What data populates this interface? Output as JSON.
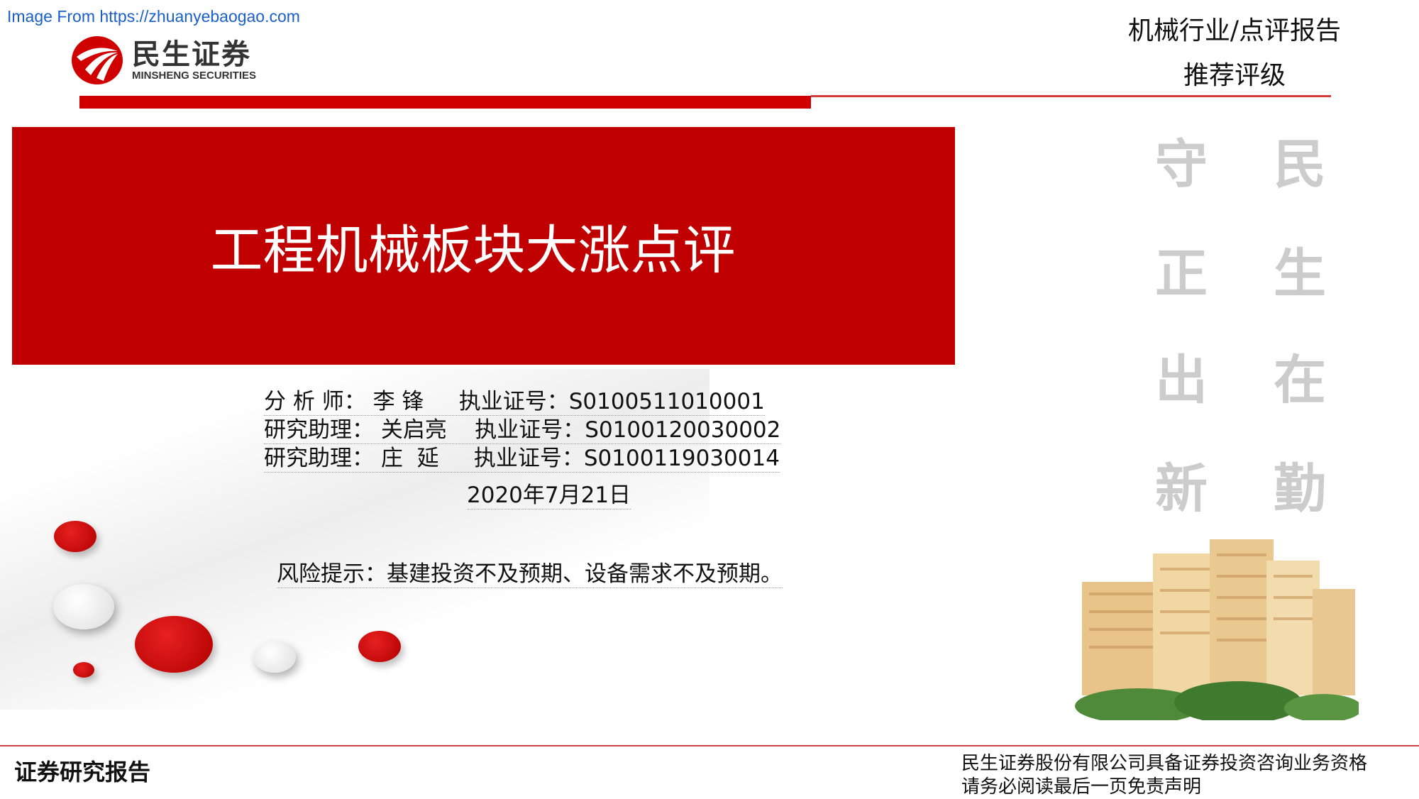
{
  "watermark": "Image From https://zhuanyebaogao.com",
  "logo": {
    "cn": "民生证券",
    "en": "MINSHENG SECURITIES",
    "color": "#d10000"
  },
  "header": {
    "category": "机械行业/点评报告",
    "rating_label": "推荐评级"
  },
  "banner": {
    "title": "工程机械板块大涨点评",
    "color": "#c00000"
  },
  "authors": [
    {
      "role": "分 析 师：",
      "name": "李 锋",
      "cert_label": "执业证号：",
      "cert": "S0100511010001"
    },
    {
      "role": "研究助理：",
      "name": "关启亮",
      "cert_label": "执业证号：",
      "cert": "S0100120030002"
    },
    {
      "role": "研究助理：",
      "name": "庄  延",
      "cert_label": "执业证号：",
      "cert": "S0100119030014"
    }
  ],
  "date": "2020年7月21日",
  "risk": "风险提示：基建投资不及预期、设备需求不及预期。",
  "motto": [
    "民",
    "生",
    "在",
    "勤",
    "守",
    "正",
    "出",
    "新"
  ],
  "footer": {
    "left": "证券研究报告",
    "right1": "民生证券股份有限公司具备证券投资咨询业务资格",
    "right2": "请务必阅读最后一页免责声明"
  }
}
